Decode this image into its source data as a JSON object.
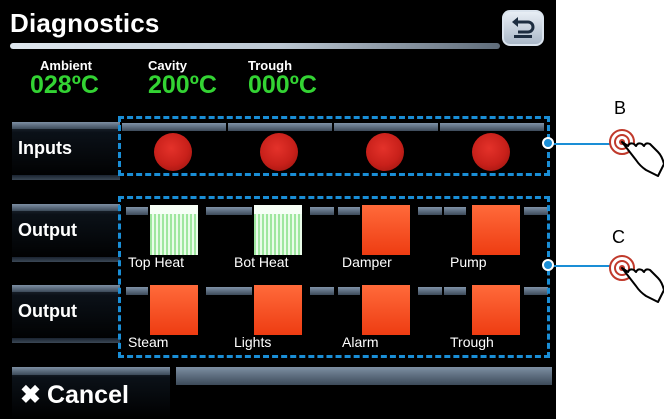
{
  "header": {
    "title": "Diagnostics",
    "back_icon": "return-arrow-icon"
  },
  "temperatures": [
    {
      "label": "Ambient",
      "value": "028ºC"
    },
    {
      "label": "Cavity",
      "value": "200ºC"
    },
    {
      "label": "Trough",
      "value": "000ºC"
    }
  ],
  "inputs": {
    "label": "Inputs",
    "indicators": [
      {
        "state": "red"
      },
      {
        "state": "red"
      },
      {
        "state": "red"
      },
      {
        "state": "red"
      }
    ]
  },
  "outputs_row1": {
    "label": "Output",
    "items": [
      {
        "name": "Top Heat",
        "state": "off"
      },
      {
        "name": "Bot Heat",
        "state": "off"
      },
      {
        "name": "Damper",
        "state": "on"
      },
      {
        "name": "Pump",
        "state": "on"
      }
    ]
  },
  "outputs_row2": {
    "label": "Output",
    "items": [
      {
        "name": "Steam",
        "state": "on"
      },
      {
        "name": "Lights",
        "state": "on"
      },
      {
        "name": "Alarm",
        "state": "on"
      },
      {
        "name": "Trough",
        "state": "on"
      }
    ]
  },
  "footer": {
    "cancel_label": "Cancel",
    "cancel_icon": "x-icon"
  },
  "callouts": {
    "b": "B",
    "c": "C"
  },
  "colors": {
    "accent": "#1a8ed6",
    "temp_value": "#33d333",
    "led_red": "#c8201a",
    "output_on": "#ee3c12"
  }
}
